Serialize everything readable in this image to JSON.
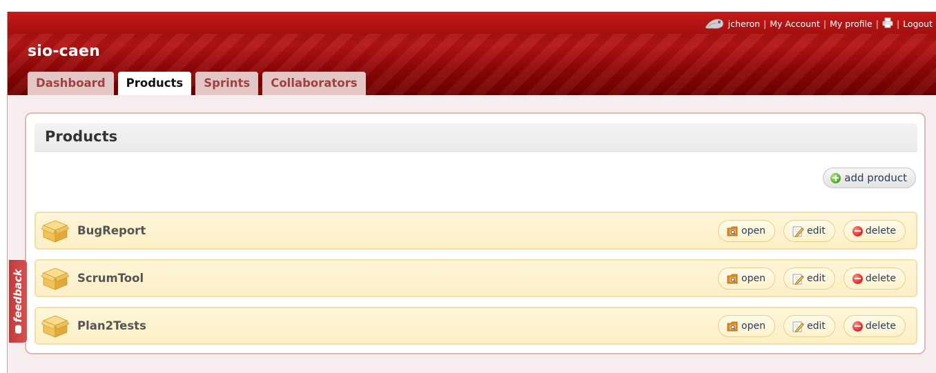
{
  "header": {
    "app_title": "sio-caen",
    "user_name": "jcheron",
    "separator": "|",
    "my_account": "My Account",
    "my_profile": "My profile",
    "logout": "Logout"
  },
  "tabs": [
    {
      "label": "Dashboard",
      "active": false
    },
    {
      "label": "Products",
      "active": true
    },
    {
      "label": "Sprints",
      "active": false
    },
    {
      "label": "Collaborators",
      "active": false
    }
  ],
  "panel": {
    "title": "Products",
    "add_button": "add product"
  },
  "products": [
    {
      "name": "BugReport"
    },
    {
      "name": "ScrumTool"
    },
    {
      "name": "Plan2Tests"
    }
  ],
  "row_actions": {
    "open": "open",
    "edit": "edit",
    "delete": "delete"
  },
  "feedback": {
    "label": "feedback"
  },
  "colors": {
    "header_red": "#a40f0f",
    "row_yellow": "#fcefc6",
    "panel_border": "#e2b6b6",
    "feedback_red": "#c43a3a"
  }
}
